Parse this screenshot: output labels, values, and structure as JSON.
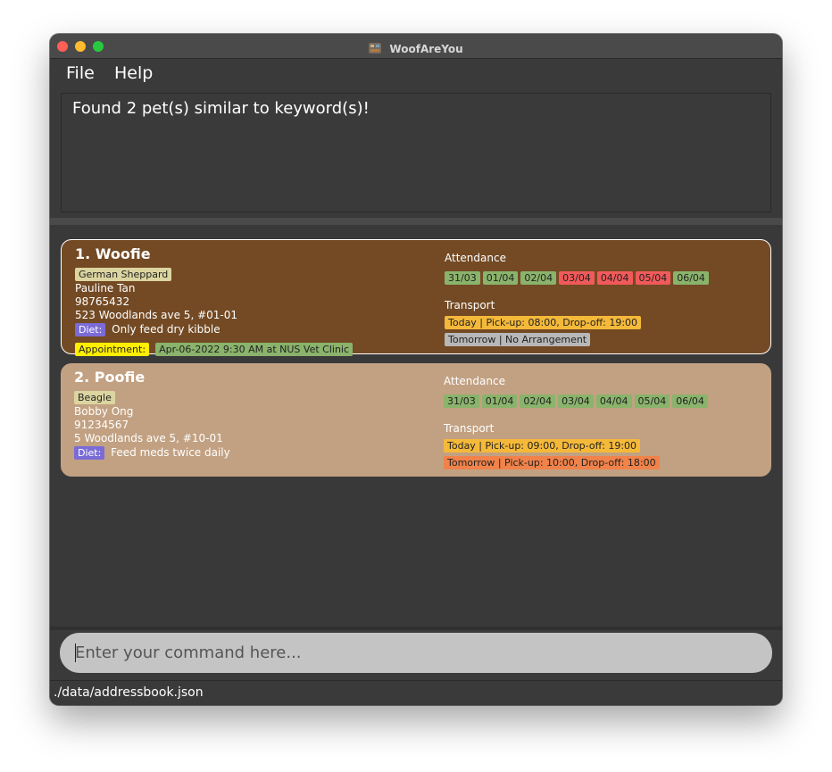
{
  "window": {
    "title": "WoofAreYou"
  },
  "menu": {
    "file": "File",
    "help": "Help"
  },
  "result": {
    "message": "Found 2 pet(s) similar to keyword(s)!"
  },
  "pets": [
    {
      "name": "1.  Woofie",
      "breed": "German Sheppard",
      "owner": "Pauline Tan",
      "phone": "98765432",
      "address": "523 Woodlands ave 5, #01-01",
      "diet_label": "Diet:",
      "diet": "Only feed dry kibble",
      "appointment_label": "Appointment:",
      "appointment": "Apr-06-2022 9:30 AM at NUS Vet Clinic",
      "attendance_label": "Attendance",
      "attendance": [
        {
          "date": "31/03",
          "status": "present"
        },
        {
          "date": "01/04",
          "status": "present"
        },
        {
          "date": "02/04",
          "status": "present"
        },
        {
          "date": "03/04",
          "status": "absent"
        },
        {
          "date": "04/04",
          "status": "absent"
        },
        {
          "date": "05/04",
          "status": "absent"
        },
        {
          "date": "06/04",
          "status": "present"
        }
      ],
      "transport_label": "Transport",
      "transport_today": "Today | Pick-up: 08:00, Drop-off: 19:00",
      "transport_tomorrow": "Tomorrow | No Arrangement"
    },
    {
      "name": "2.  Poofie",
      "breed": "Beagle",
      "owner": "Bobby Ong",
      "phone": "91234567",
      "address": "5 Woodlands ave 5, #10-01",
      "diet_label": "Diet:",
      "diet": "Feed meds twice daily",
      "attendance_label": "Attendance",
      "attendance": [
        {
          "date": "31/03",
          "status": "present"
        },
        {
          "date": "01/04",
          "status": "present"
        },
        {
          "date": "02/04",
          "status": "present"
        },
        {
          "date": "03/04",
          "status": "present"
        },
        {
          "date": "04/04",
          "status": "present"
        },
        {
          "date": "05/04",
          "status": "present"
        },
        {
          "date": "06/04",
          "status": "present"
        }
      ],
      "transport_label": "Transport",
      "transport_today": "Today | Pick-up: 09:00, Drop-off: 19:00",
      "transport_tomorrow": "Tomorrow | Pick-up: 10:00, Drop-off: 18:00"
    }
  ],
  "command": {
    "placeholder": "Enter your command here..."
  },
  "status": {
    "path": "./data/addressbook.json"
  },
  "colors": {
    "card1_bg": "#734a24",
    "card2_bg": "#c2a182",
    "present": "#8ab36b",
    "absent": "#f05a5a",
    "today_transport": "#f5b93a",
    "no_arrangement": "#b8b8b8",
    "tomorrow_transport": "#f0824a"
  }
}
